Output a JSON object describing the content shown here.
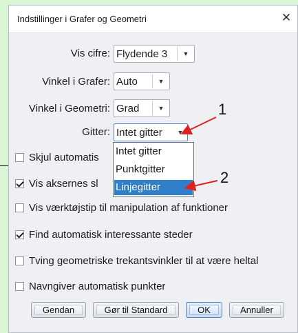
{
  "dialog": {
    "title": "Indstillinger i Grafer og Geometri",
    "close_symbol": "✕"
  },
  "settings": {
    "digits": {
      "label": "Vis cifre:",
      "value": "Flydende 3"
    },
    "angle_graphs": {
      "label": "Vinkel i Grafer:",
      "value": "Auto"
    },
    "angle_geometry": {
      "label": "Vinkel i Geometri:",
      "value": "Grad"
    },
    "grid": {
      "label": "Gitter:",
      "value": "Intet gitter"
    }
  },
  "grid_dropdown": {
    "options": [
      "Intet gitter",
      "Punktgitter",
      "Linjegitter"
    ],
    "highlighted": "Linjegitter"
  },
  "checkboxes": [
    {
      "label": "Skjul automatis",
      "checked": false
    },
    {
      "label": "Vis aksernes sl",
      "checked": true
    },
    {
      "label": "Vis værktøjstip til manipulation af funktioner",
      "checked": false
    },
    {
      "label": "Find automatisk interessante steder",
      "checked": true
    },
    {
      "label": "Tving geometriske trekantsvinkler til at være heltal",
      "checked": false
    },
    {
      "label": "Navngiver automatisk punkter",
      "checked": false
    }
  ],
  "buttons": {
    "restore": "Gendan",
    "make_default": "Gør til Standard",
    "ok": "OK",
    "cancel": "Annuller"
  },
  "annotations": {
    "marker_1": "1",
    "marker_2": "2",
    "arrow_color": "#e0201c"
  },
  "colors": {
    "background": "#d9f7d4",
    "highlight": "#2f7fc9"
  }
}
